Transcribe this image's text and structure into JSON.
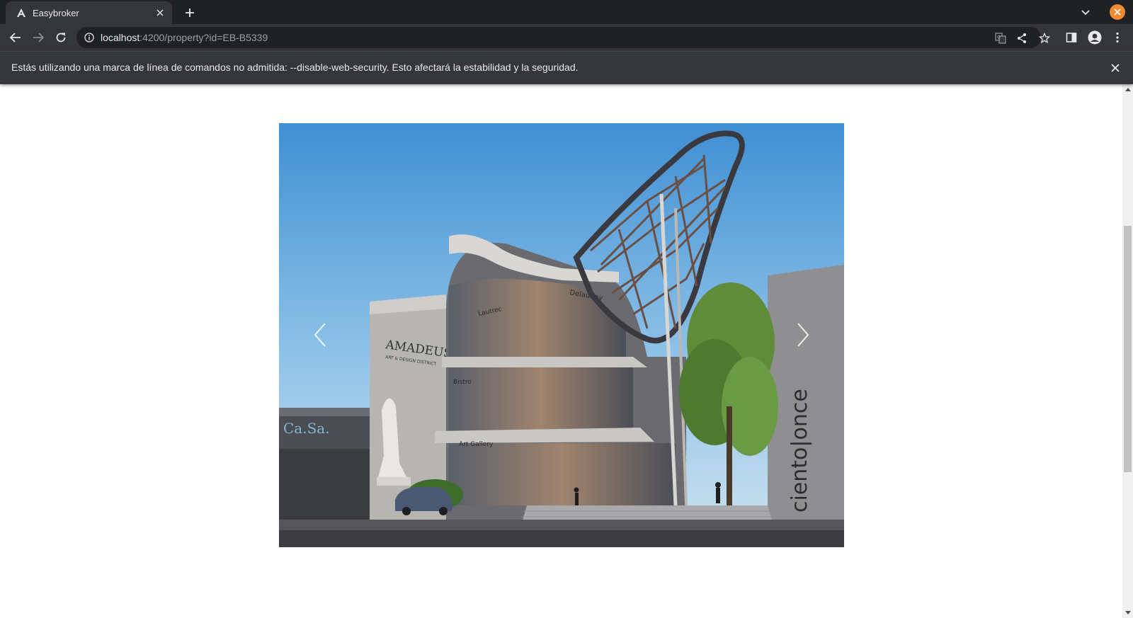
{
  "browser": {
    "tab": {
      "title": "Easybroker",
      "favicon": "angular-a-icon"
    },
    "new_tab_icon": "plus-icon",
    "url_host": "localhost",
    "url_rest": ":4200/property?id=EB-B5339",
    "toolbar_icons": [
      "translate-icon",
      "share-icon",
      "star-icon",
      "side-panel-icon",
      "profile-icon",
      "kebab-menu-icon"
    ]
  },
  "infobar": {
    "message": "Estás utilizando una marca de línea de comandos no admitida: --disable-web-security. Esto afectará la estabilidad y la seguridad."
  },
  "carousel": {
    "image_signage": {
      "building_left": "AMADEUS",
      "building_left_sub": "ART & DESIGN DISTRICT",
      "building_right": "ciento|once",
      "store_sign": "Ca.Sa.",
      "floor_sign_1": "Delaunay",
      "floor_sign_2": "Lautrec",
      "floor_sign_3": "Bistro",
      "floor_sign_4": "Art Gallery"
    },
    "prev_icon": "chevron-left-icon",
    "next_icon": "chevron-right-icon"
  },
  "colors": {
    "tabstrip": "#202124",
    "toolbar": "#35363a",
    "window_close": "#f28b30"
  }
}
